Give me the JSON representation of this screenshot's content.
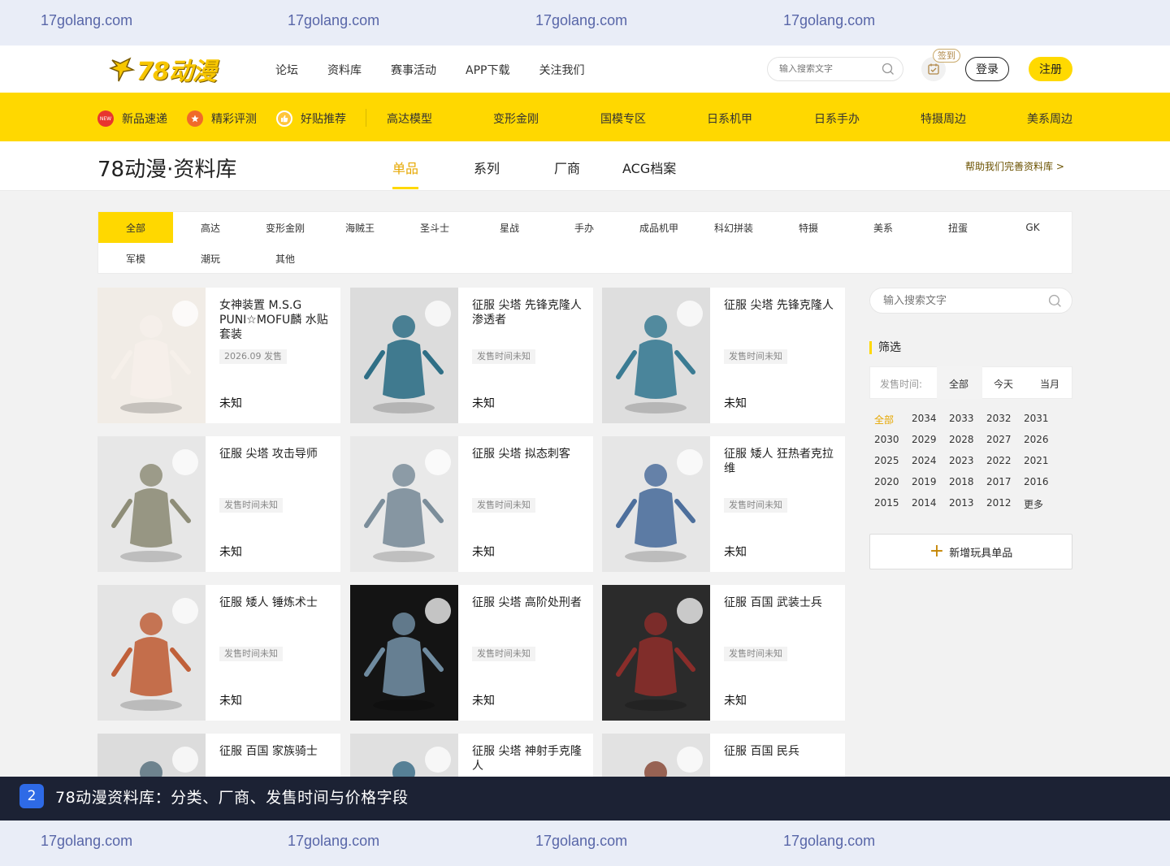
{
  "watermark": {
    "text": "17golang.com"
  },
  "header": {
    "logo_text": "78动漫",
    "nav": [
      "论坛",
      "资料库",
      "赛事活动",
      "APP下载",
      "关注我们"
    ],
    "search_placeholder": "输入搜索文字",
    "signin_tag": "签到",
    "login": "登录",
    "register": "注册"
  },
  "yellow_nav": {
    "items": [
      {
        "label": "新品速递",
        "icon": "new-icon",
        "color": "#e8352f",
        "icon_text": "NEW"
      },
      {
        "label": "精彩评测",
        "icon": "star-badge-icon",
        "color": "#f06a2a",
        "icon_text": ""
      },
      {
        "label": "好贴推荐",
        "icon": "thumb-icon",
        "color": "#ffc53a",
        "icon_text": ""
      },
      {
        "label": "高达模型"
      },
      {
        "label": "变形金刚"
      },
      {
        "label": "国模专区"
      },
      {
        "label": "日系机甲"
      },
      {
        "label": "日系手办"
      },
      {
        "label": "特摄周边"
      },
      {
        "label": "美系周边"
      }
    ]
  },
  "subhead": {
    "title": "78动漫·资料库",
    "tabs": [
      "单品",
      "系列",
      "厂商",
      "ACG档案"
    ],
    "active_tab": "单品",
    "help": "帮助我们完善资料库 >"
  },
  "categories": [
    "全部",
    "高达",
    "变形金刚",
    "海贼王",
    "圣斗士",
    "星战",
    "手办",
    "成品机甲",
    "科幻拼装",
    "特摄",
    "美系",
    "扭蛋",
    "GK",
    "军模",
    "潮玩",
    "其他"
  ],
  "active_category": "全部",
  "cards": [
    {
      "title": "女神装置 M.S.G PUNI☆MOFU麟 水贴套装",
      "date": "2026.09 发售",
      "price": "未知",
      "img_bg": "#f1ece6",
      "fig": "#f6f0ea"
    },
    {
      "title": "征服 尖塔 先锋克隆人渗透者",
      "date": "发售时间未知",
      "price": "未知",
      "img_bg": "#dcdcdc",
      "fig": "#2f6f86"
    },
    {
      "title": "征服 尖塔 先锋克隆人",
      "date": "发售时间未知",
      "price": "未知",
      "img_bg": "#dedede",
      "fig": "#3a7b93"
    },
    {
      "title": "征服 尖塔 攻击导师",
      "date": "发售时间未知",
      "price": "未知",
      "img_bg": "#e7e7e7",
      "fig": "#8e8d78"
    },
    {
      "title": "征服 尖塔 拟态刺客",
      "date": "发售时间未知",
      "price": "未知",
      "img_bg": "#e9e9e9",
      "fig": "#7b8d9a"
    },
    {
      "title": "征服 矮人 狂热者克拉维",
      "date": "发售时间未知",
      "price": "未知",
      "img_bg": "#e6e6e6",
      "fig": "#4d6f9c"
    },
    {
      "title": "征服 矮人 锤炼术士",
      "date": "发售时间未知",
      "price": "未知",
      "img_bg": "#e4e4e4",
      "fig": "#c0603a"
    },
    {
      "title": "征服 尖塔 高阶处刑者",
      "date": "发售时间未知",
      "price": "未知",
      "img_bg": "#141414",
      "fig": "#6f8ba0"
    },
    {
      "title": "征服 百国 武装士兵",
      "date": "发售时间未知",
      "price": "未知",
      "img_bg": "#2b2b2b",
      "fig": "#8a2d2a"
    },
    {
      "title": "征服 百国 家族骑士",
      "date": "",
      "price": "",
      "img_bg": "#dcdcdc",
      "fig": "#5a7380"
    },
    {
      "title": "征服 尖塔 神射手克隆人",
      "date": "",
      "price": "",
      "img_bg": "#e0e0e0",
      "fig": "#3d6e88"
    },
    {
      "title": "征服 百国 民兵",
      "date": "",
      "price": "",
      "img_bg": "#e2e2e2",
      "fig": "#8a4b3a"
    }
  ],
  "sidebar": {
    "search_placeholder": "输入搜索文字",
    "filter_title": "筛选",
    "time_label": "发售时间:",
    "time_tabs": [
      "全部",
      "今天",
      "当月"
    ],
    "years": [
      "全部",
      "2034",
      "2033",
      "2032",
      "2031",
      "2030",
      "2029",
      "2028",
      "2027",
      "2026",
      "2025",
      "2024",
      "2023",
      "2022",
      "2021",
      "2020",
      "2019",
      "2018",
      "2017",
      "2016",
      "2015",
      "2014",
      "2013",
      "2012",
      "更多"
    ],
    "add_button": "新增玩具单品"
  },
  "caption": {
    "num": "2",
    "text": "78动漫资料库：分类、厂商、发售时间与价格字段"
  },
  "colors": {
    "accent": "#ffd800",
    "accent_text": "#e6a700",
    "caption_bg": "#1c2234"
  }
}
